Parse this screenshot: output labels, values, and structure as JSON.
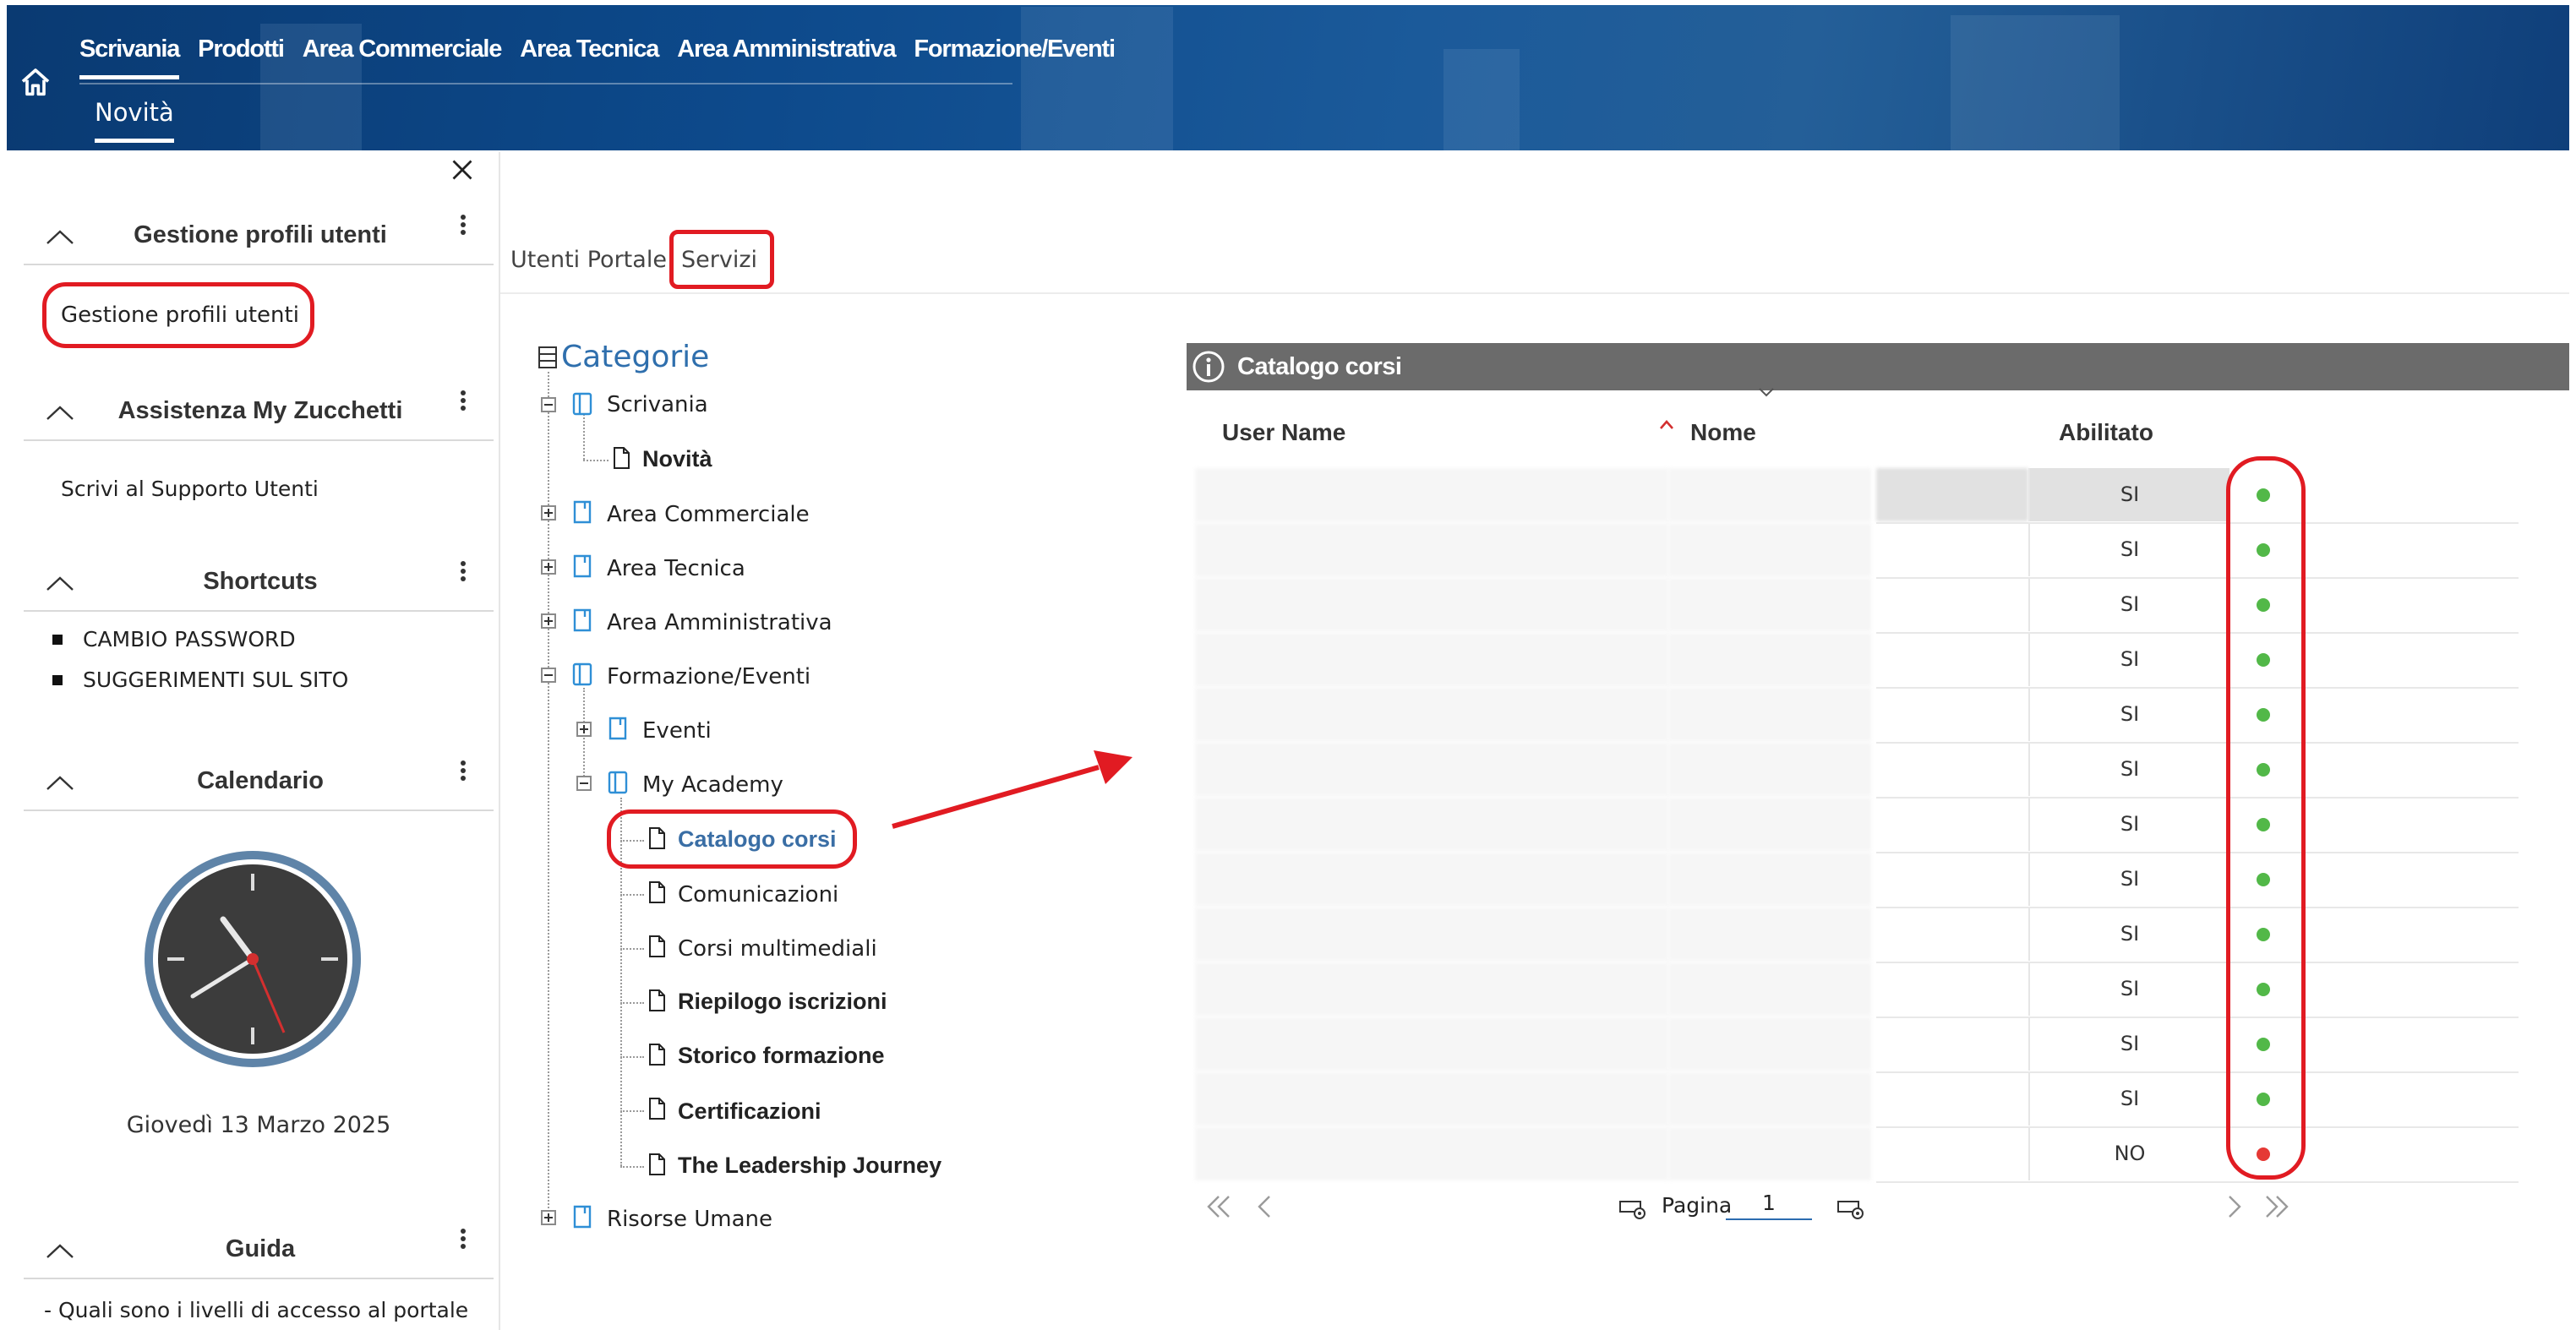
{
  "header": {
    "nav": [
      "Scrivania",
      "Prodotti",
      "Area Commerciale",
      "Area Tecnica",
      "Area Amministrativa",
      "Formazione/Eventi"
    ],
    "active_nav": "Scrivania",
    "subnav": "Novità"
  },
  "sidebar": {
    "panels": {
      "gestione": {
        "title": "Gestione profili utenti",
        "link": "Gestione profili utenti"
      },
      "assistenza": {
        "title": "Assistenza My Zucchetti",
        "link": "Scrivi al Supporto Utenti"
      },
      "shortcuts": {
        "title": "Shortcuts",
        "items": [
          "CAMBIO PASSWORD",
          "SUGGERIMENTI SUL SITO"
        ]
      },
      "calendario": {
        "title": "Calendario",
        "date": "Giovedì 13 Marzo 2025"
      },
      "guida": {
        "title": "Guida",
        "item": "-  Quali sono i livelli di accesso al portale"
      }
    }
  },
  "tabs": [
    "Utenti Portale",
    "Servizi"
  ],
  "active_tab": "Servizi",
  "tree": {
    "title": "Categorie",
    "nodes": {
      "scrivania": "Scrivania",
      "novita": "Novità",
      "area_commerciale": "Area Commerciale",
      "area_tecnica": "Area Tecnica",
      "area_amministrativa": "Area Amministrativa",
      "formazione": "Formazione/Eventi",
      "eventi": "Eventi",
      "my_academy": "My Academy",
      "catalogo_corsi": "Catalogo corsi",
      "comunicazioni": "Comunicazioni",
      "corsi_multimediali": "Corsi multimediali",
      "riepilogo": "Riepilogo iscrizioni",
      "storico": "Storico formazione",
      "certificazioni": "Certificazioni",
      "leadership": "The Leadership Journey",
      "risorse_umane": "Risorse Umane"
    }
  },
  "grid": {
    "title": "Catalogo corsi",
    "columns": {
      "user": "User Name",
      "nome": "Nome",
      "abilitato": "Abilitato"
    },
    "rows": [
      {
        "abilitato": "SI",
        "status": "green"
      },
      {
        "abilitato": "SI",
        "status": "green"
      },
      {
        "abilitato": "SI",
        "status": "green"
      },
      {
        "abilitato": "SI",
        "status": "green"
      },
      {
        "abilitato": "SI",
        "status": "green"
      },
      {
        "abilitato": "SI",
        "status": "green"
      },
      {
        "abilitato": "SI",
        "status": "green"
      },
      {
        "abilitato": "SI",
        "status": "green"
      },
      {
        "abilitato": "SI",
        "status": "green"
      },
      {
        "abilitato": "SI",
        "status": "green"
      },
      {
        "abilitato": "SI",
        "status": "green"
      },
      {
        "abilitato": "SI",
        "status": "green"
      },
      {
        "abilitato": "NO",
        "status": "red"
      }
    ],
    "pager": {
      "label": "Pagina",
      "page": "1"
    }
  },
  "colors": {
    "green": "#52b848",
    "red": "#e53935",
    "highlight": "#e11b22",
    "link_blue": "#3a6ea5",
    "header_dark": "#0a3a72",
    "grid_title_bg": "#6b6b6b"
  }
}
